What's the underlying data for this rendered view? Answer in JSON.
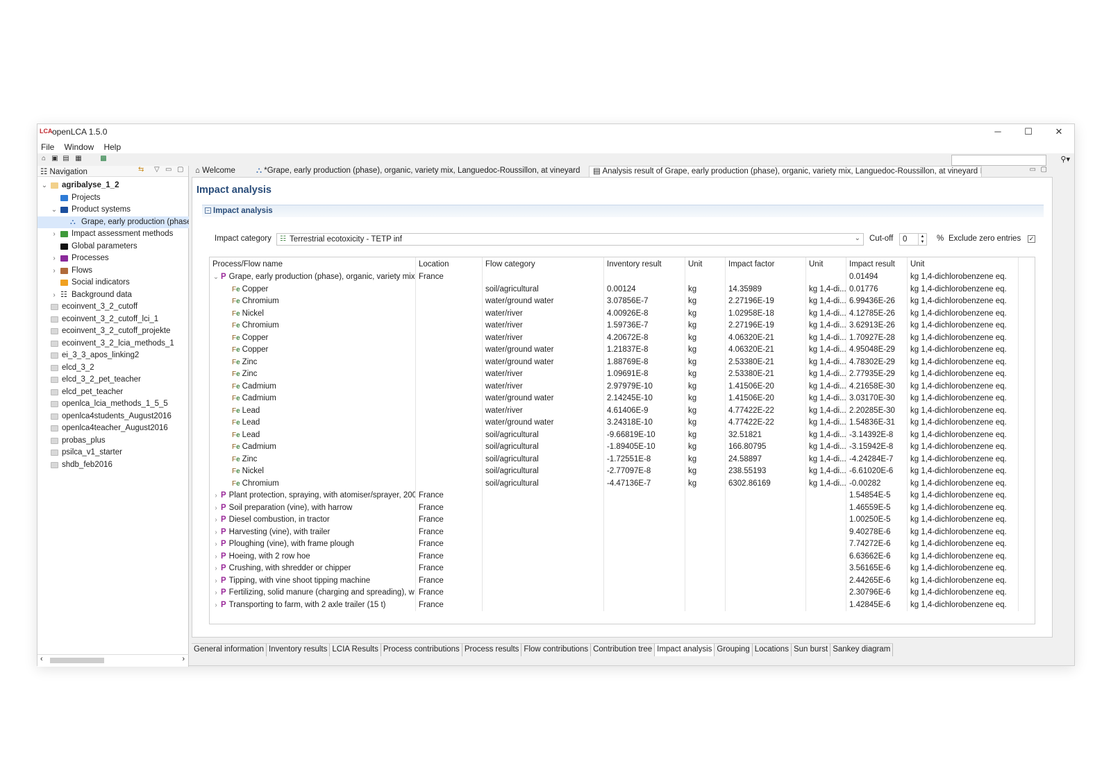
{
  "app": {
    "title": "openLCA 1.5.0",
    "logo": "LCA"
  },
  "window_controls": {
    "minimize": "─",
    "maximize": "☐",
    "close": "✕"
  },
  "menu": [
    "File",
    "Window",
    "Help"
  ],
  "toolbar": {
    "icons": [
      "home-icon",
      "save-icon",
      "save-as-icon",
      "save-all-icon",
      "excel-icon"
    ]
  },
  "navigation": {
    "title": "Navigation",
    "items": [
      {
        "label": "agribalyse_1_2",
        "level": 0,
        "arrow": "v",
        "icon": "db-open",
        "bold": true
      },
      {
        "label": "Projects",
        "level": 1,
        "arrow": "",
        "icon": "folder-blue"
      },
      {
        "label": "Product systems",
        "level": 1,
        "arrow": "v",
        "icon": "folder-darkblue"
      },
      {
        "label": "Grape, early production (phase",
        "level": 2,
        "arrow": "",
        "icon": "product-system",
        "selected": true
      },
      {
        "label": "Impact assessment methods",
        "level": 1,
        "arrow": ">",
        "icon": "folder-green"
      },
      {
        "label": "Global parameters",
        "level": 1,
        "arrow": "",
        "icon": "folder-black"
      },
      {
        "label": "Processes",
        "level": 1,
        "arrow": ">",
        "icon": "folder-purple"
      },
      {
        "label": "Flows",
        "level": 1,
        "arrow": ">",
        "icon": "folder-brown"
      },
      {
        "label": "Social indicators",
        "level": 1,
        "arrow": "",
        "icon": "folder-orange"
      },
      {
        "label": "Background data",
        "level": 1,
        "arrow": ">",
        "icon": "grid"
      },
      {
        "label": "ecoinvent_3_2_cutoff",
        "level": 0,
        "arrow": "",
        "icon": "db"
      },
      {
        "label": "ecoinvent_3_2_cutoff_lci_1",
        "level": 0,
        "arrow": "",
        "icon": "db"
      },
      {
        "label": "ecoinvent_3_2_cutoff_projekte",
        "level": 0,
        "arrow": "",
        "icon": "db"
      },
      {
        "label": "ecoinvent_3_2_lcia_methods_1",
        "level": 0,
        "arrow": "",
        "icon": "db"
      },
      {
        "label": "ei_3_3_apos_linking2",
        "level": 0,
        "arrow": "",
        "icon": "db"
      },
      {
        "label": "elcd_3_2",
        "level": 0,
        "arrow": "",
        "icon": "db"
      },
      {
        "label": "elcd_3_2_pet_teacher",
        "level": 0,
        "arrow": "",
        "icon": "db"
      },
      {
        "label": "elcd_pet_teacher",
        "level": 0,
        "arrow": "",
        "icon": "db"
      },
      {
        "label": "openlca_lcia_methods_1_5_5",
        "level": 0,
        "arrow": "",
        "icon": "db"
      },
      {
        "label": "openlca4students_August2016",
        "level": 0,
        "arrow": "",
        "icon": "db"
      },
      {
        "label": "openlca4teacher_August2016",
        "level": 0,
        "arrow": "",
        "icon": "db"
      },
      {
        "label": "probas_plus",
        "level": 0,
        "arrow": "",
        "icon": "db"
      },
      {
        "label": "psilca_v1_starter",
        "level": 0,
        "arrow": "",
        "icon": "db"
      },
      {
        "label": "shdb_feb2016",
        "level": 0,
        "arrow": "",
        "icon": "db"
      }
    ]
  },
  "editor_tabs": [
    {
      "label": "Welcome",
      "icon": "home-icon"
    },
    {
      "label": "*Grape, early production (phase), organic, variety mix, Languedoc-Roussillon, at vineyard",
      "icon": "product-system-icon"
    },
    {
      "label": "Analysis result of Grape, early production (phase), organic, variety mix, Languedoc-Roussillon, at vineyard",
      "icon": "analysis-icon",
      "close": "☒",
      "active": true
    }
  ],
  "page": {
    "title": "Impact analysis",
    "section": "Impact analysis",
    "impact_category_label": "Impact category",
    "impact_category_value": "Terrestrial ecotoxicity - TETP inf",
    "cutoff_label": "Cut-off",
    "cutoff_value": "0",
    "percent": "%",
    "exclude_zero_label": "Exclude zero entries",
    "exclude_zero_checked": true
  },
  "table": {
    "headers": [
      "Process/Flow name",
      "Location",
      "Flow category",
      "Inventory result",
      "Unit",
      "Impact factor",
      "Unit",
      "Impact result",
      "Unit"
    ],
    "rows": [
      {
        "kind": "process",
        "expanded": true,
        "name": "Grape, early production (phase), organic, variety mix, Languedoc-Roussillon, at vineyard",
        "location": "France",
        "category": "",
        "inventory": "",
        "unit1": "",
        "factor": "",
        "unit2": "",
        "result": "0.01494",
        "unit3": "kg 1,4-dichlorobenzene eq."
      },
      {
        "kind": "flow",
        "name": "Copper",
        "location": "",
        "category": "soil/agricultural",
        "inventory": "0.00124",
        "unit1": "kg",
        "factor": "14.35989",
        "unit2": "kg 1,4-di...",
        "result": "0.01776",
        "unit3": "kg 1,4-dichlorobenzene eq."
      },
      {
        "kind": "flow",
        "name": "Chromium",
        "location": "",
        "category": "water/ground water",
        "inventory": "3.07856E-7",
        "unit1": "kg",
        "factor": "2.27196E-19",
        "unit2": "kg 1,4-di...",
        "result": "6.99436E-26",
        "unit3": "kg 1,4-dichlorobenzene eq."
      },
      {
        "kind": "flow",
        "name": "Nickel",
        "location": "",
        "category": "water/river",
        "inventory": "4.00926E-8",
        "unit1": "kg",
        "factor": "1.02958E-18",
        "unit2": "kg 1,4-di...",
        "result": "4.12785E-26",
        "unit3": "kg 1,4-dichlorobenzene eq."
      },
      {
        "kind": "flow",
        "name": "Chromium",
        "location": "",
        "category": "water/river",
        "inventory": "1.59736E-7",
        "unit1": "kg",
        "factor": "2.27196E-19",
        "unit2": "kg 1,4-di...",
        "result": "3.62913E-26",
        "unit3": "kg 1,4-dichlorobenzene eq."
      },
      {
        "kind": "flow",
        "name": "Copper",
        "location": "",
        "category": "water/river",
        "inventory": "4.20672E-8",
        "unit1": "kg",
        "factor": "4.06320E-21",
        "unit2": "kg 1,4-di...",
        "result": "1.70927E-28",
        "unit3": "kg 1,4-dichlorobenzene eq."
      },
      {
        "kind": "flow",
        "name": "Copper",
        "location": "",
        "category": "water/ground water",
        "inventory": "1.21837E-8",
        "unit1": "kg",
        "factor": "4.06320E-21",
        "unit2": "kg 1,4-di...",
        "result": "4.95048E-29",
        "unit3": "kg 1,4-dichlorobenzene eq."
      },
      {
        "kind": "flow",
        "name": "Zinc",
        "location": "",
        "category": "water/ground water",
        "inventory": "1.88769E-8",
        "unit1": "kg",
        "factor": "2.53380E-21",
        "unit2": "kg 1,4-di...",
        "result": "4.78302E-29",
        "unit3": "kg 1,4-dichlorobenzene eq."
      },
      {
        "kind": "flow",
        "name": "Zinc",
        "location": "",
        "category": "water/river",
        "inventory": "1.09691E-8",
        "unit1": "kg",
        "factor": "2.53380E-21",
        "unit2": "kg 1,4-di...",
        "result": "2.77935E-29",
        "unit3": "kg 1,4-dichlorobenzene eq."
      },
      {
        "kind": "flow",
        "name": "Cadmium",
        "location": "",
        "category": "water/river",
        "inventory": "2.97979E-10",
        "unit1": "kg",
        "factor": "1.41506E-20",
        "unit2": "kg 1,4-di...",
        "result": "4.21658E-30",
        "unit3": "kg 1,4-dichlorobenzene eq."
      },
      {
        "kind": "flow",
        "name": "Cadmium",
        "location": "",
        "category": "water/ground water",
        "inventory": "2.14245E-10",
        "unit1": "kg",
        "factor": "1.41506E-20",
        "unit2": "kg 1,4-di...",
        "result": "3.03170E-30",
        "unit3": "kg 1,4-dichlorobenzene eq."
      },
      {
        "kind": "flow",
        "name": "Lead",
        "location": "",
        "category": "water/river",
        "inventory": "4.61406E-9",
        "unit1": "kg",
        "factor": "4.77422E-22",
        "unit2": "kg 1,4-di...",
        "result": "2.20285E-30",
        "unit3": "kg 1,4-dichlorobenzene eq."
      },
      {
        "kind": "flow",
        "name": "Lead",
        "location": "",
        "category": "water/ground water",
        "inventory": "3.24318E-10",
        "unit1": "kg",
        "factor": "4.77422E-22",
        "unit2": "kg 1,4-di...",
        "result": "1.54836E-31",
        "unit3": "kg 1,4-dichlorobenzene eq."
      },
      {
        "kind": "flow",
        "name": "Lead",
        "location": "",
        "category": "soil/agricultural",
        "inventory": "-9.66819E-10",
        "unit1": "kg",
        "factor": "32.51821",
        "unit2": "kg 1,4-di...",
        "result": "-3.14392E-8",
        "unit3": "kg 1,4-dichlorobenzene eq."
      },
      {
        "kind": "flow",
        "name": "Cadmium",
        "location": "",
        "category": "soil/agricultural",
        "inventory": "-1.89405E-10",
        "unit1": "kg",
        "factor": "166.80795",
        "unit2": "kg 1,4-di...",
        "result": "-3.15942E-8",
        "unit3": "kg 1,4-dichlorobenzene eq."
      },
      {
        "kind": "flow",
        "name": "Zinc",
        "location": "",
        "category": "soil/agricultural",
        "inventory": "-1.72551E-8",
        "unit1": "kg",
        "factor": "24.58897",
        "unit2": "kg 1,4-di...",
        "result": "-4.24284E-7",
        "unit3": "kg 1,4-dichlorobenzene eq."
      },
      {
        "kind": "flow",
        "name": "Nickel",
        "location": "",
        "category": "soil/agricultural",
        "inventory": "-2.77097E-8",
        "unit1": "kg",
        "factor": "238.55193",
        "unit2": "kg 1,4-di...",
        "result": "-6.61020E-6",
        "unit3": "kg 1,4-dichlorobenzene eq."
      },
      {
        "kind": "flow",
        "name": "Chromium",
        "location": "",
        "category": "soil/agricultural",
        "inventory": "-4.47136E-7",
        "unit1": "kg",
        "factor": "6302.86169",
        "unit2": "kg 1,4-di...",
        "result": "-0.00282",
        "unit3": "kg 1,4-dichlorobenzene eq."
      },
      {
        "kind": "process",
        "expanded": false,
        "name": "Plant protection, spraying, with atomiser/sprayer, 200",
        "location": "France",
        "category": "",
        "inventory": "",
        "unit1": "",
        "factor": "",
        "unit2": "",
        "result": "1.54854E-5",
        "unit3": "kg 1,4-dichlorobenzene eq."
      },
      {
        "kind": "process",
        "expanded": false,
        "name": "Soil preparation (vine), with harrow",
        "location": "France",
        "category": "",
        "inventory": "",
        "unit1": "",
        "factor": "",
        "unit2": "",
        "result": "1.46559E-5",
        "unit3": "kg 1,4-dichlorobenzene eq."
      },
      {
        "kind": "process",
        "expanded": false,
        "name": "Diesel combustion, in tractor",
        "location": "France",
        "category": "",
        "inventory": "",
        "unit1": "",
        "factor": "",
        "unit2": "",
        "result": "1.00250E-5",
        "unit3": "kg 1,4-dichlorobenzene eq."
      },
      {
        "kind": "process",
        "expanded": false,
        "name": "Harvesting (vine), with trailer",
        "location": "France",
        "category": "",
        "inventory": "",
        "unit1": "",
        "factor": "",
        "unit2": "",
        "result": "9.40278E-6",
        "unit3": "kg 1,4-dichlorobenzene eq."
      },
      {
        "kind": "process",
        "expanded": false,
        "name": "Ploughing (vine), with frame plough",
        "location": "France",
        "category": "",
        "inventory": "",
        "unit1": "",
        "factor": "",
        "unit2": "",
        "result": "7.74272E-6",
        "unit3": "kg 1,4-dichlorobenzene eq."
      },
      {
        "kind": "process",
        "expanded": false,
        "name": "Hoeing, with 2 row hoe",
        "location": "France",
        "category": "",
        "inventory": "",
        "unit1": "",
        "factor": "",
        "unit2": "",
        "result": "6.63662E-6",
        "unit3": "kg 1,4-dichlorobenzene eq."
      },
      {
        "kind": "process",
        "expanded": false,
        "name": "Crushing, with shredder or chipper",
        "location": "France",
        "category": "",
        "inventory": "",
        "unit1": "",
        "factor": "",
        "unit2": "",
        "result": "3.56165E-6",
        "unit3": "kg 1,4-dichlorobenzene eq."
      },
      {
        "kind": "process",
        "expanded": false,
        "name": "Tipping, with vine shoot tipping machine",
        "location": "France",
        "category": "",
        "inventory": "",
        "unit1": "",
        "factor": "",
        "unit2": "",
        "result": "2.44265E-6",
        "unit3": "kg 1,4-dichlorobenzene eq."
      },
      {
        "kind": "process",
        "expanded": false,
        "name": "Fertilizing, solid manure (charging and spreading), w",
        "location": "France",
        "category": "",
        "inventory": "",
        "unit1": "",
        "factor": "",
        "unit2": "",
        "result": "2.30796E-6",
        "unit3": "kg 1,4-dichlorobenzene eq."
      },
      {
        "kind": "process",
        "expanded": false,
        "name": "Transporting to farm, with 2 axle trailer (15 t)",
        "location": "France",
        "category": "",
        "inventory": "",
        "unit1": "",
        "factor": "",
        "unit2": "",
        "result": "1.42845E-6",
        "unit3": "kg 1,4-dichlorobenzene eq."
      }
    ]
  },
  "bottom_tabs": [
    {
      "label": "General information"
    },
    {
      "label": "Inventory results"
    },
    {
      "label": "LCIA Results"
    },
    {
      "label": "Process contributions"
    },
    {
      "label": "Process results"
    },
    {
      "label": "Flow contributions"
    },
    {
      "label": "Contribution tree"
    },
    {
      "label": "Impact analysis",
      "active": true
    },
    {
      "label": "Grouping"
    },
    {
      "label": "Locations"
    },
    {
      "label": "Sun burst"
    },
    {
      "label": "Sankey diagram"
    }
  ],
  "colors": {
    "title_blue": "#2a4d7a",
    "process_icon": "#9a2a9a",
    "selection": "#d9e8fb"
  }
}
